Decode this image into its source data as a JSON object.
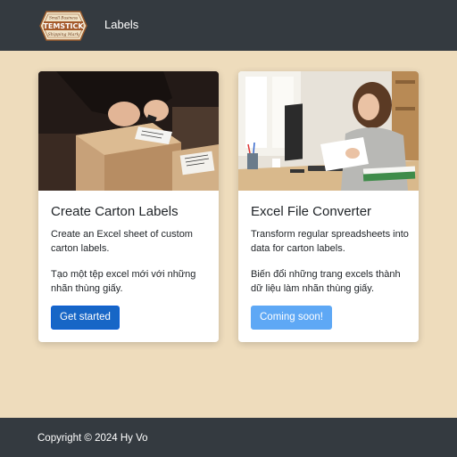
{
  "navbar": {
    "logo": {
      "top_text": "Small Business",
      "brand": "TEMSTICK",
      "tagline": "Shipping Mark"
    },
    "link_label": "Labels"
  },
  "cards": [
    {
      "title": "Create Carton Labels",
      "text_en": "Create an Excel sheet of custom carton labels.",
      "text_vi": "Tạo một tệp excel mới với những nhãn thùng giấy.",
      "button_label": "Get started",
      "button_state": "enabled"
    },
    {
      "title": "Excel File Converter",
      "text_en": "Transform regular spreadsheets into data for carton labels.",
      "text_vi": "Biến đổi những trang excels thành dữ liệu làm nhãn thùng giấy.",
      "button_label": "Coming soon!",
      "button_state": "disabled"
    }
  ],
  "footer": {
    "copyright": "Copyright © 2024 Hy Vo"
  },
  "colors": {
    "page_background": "#eedcbc",
    "navbar_background": "#343a40",
    "primary_button": "#1766c6",
    "disabled_button": "#5ea8f5"
  }
}
